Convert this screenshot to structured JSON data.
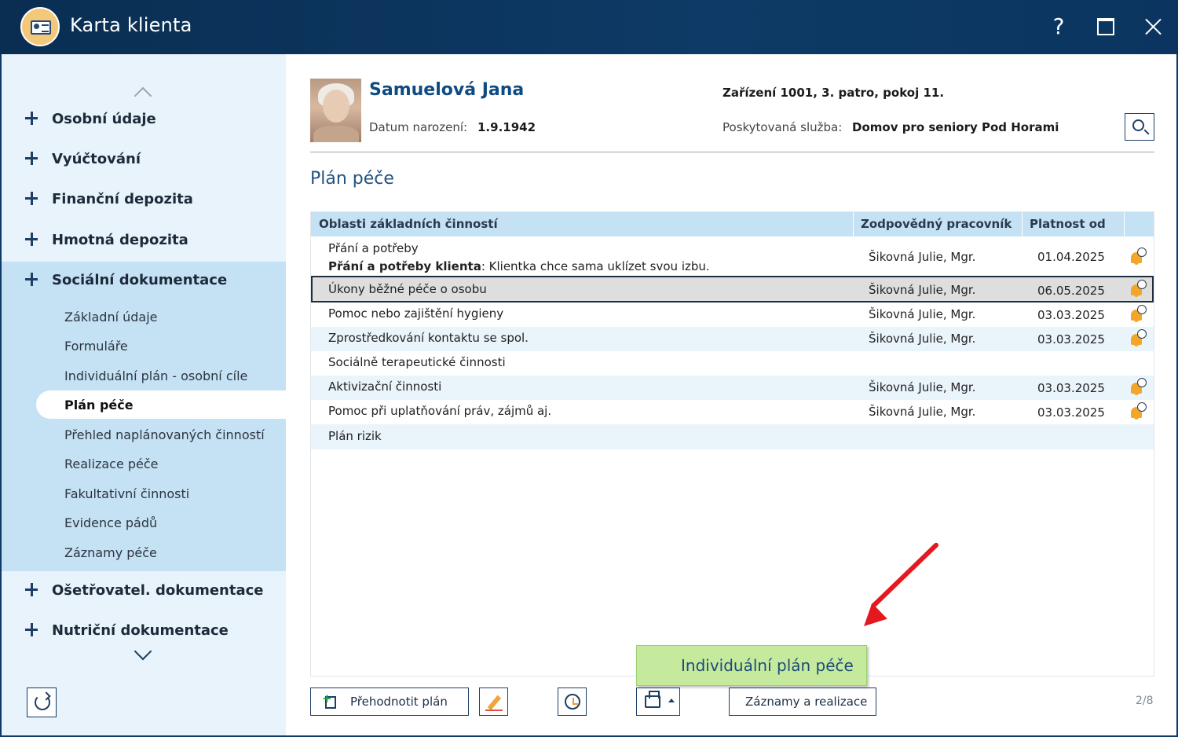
{
  "window": {
    "title": "Karta klienta",
    "help_label": "?"
  },
  "sidebar": {
    "items": [
      {
        "label": "Osobní údaje"
      },
      {
        "label": "Vyúčtování"
      },
      {
        "label": "Finanční depozita"
      },
      {
        "label": "Hmotná depozita"
      },
      {
        "label": "Sociální dokumentace"
      },
      {
        "label": "Ošetřovatel. dokumentace"
      },
      {
        "label": "Nutriční dokumentace"
      }
    ],
    "social_children": [
      {
        "label": "Základní údaje"
      },
      {
        "label": "Formuláře"
      },
      {
        "label": "Individuální plán - osobní cíle"
      },
      {
        "label": "Plán péče"
      },
      {
        "label": "Přehled naplánovaných činností"
      },
      {
        "label": "Realizace péče"
      },
      {
        "label": "Fakultativní činnosti"
      },
      {
        "label": "Evidence pádů"
      },
      {
        "label": "Záznamy péče"
      }
    ],
    "active_child": "Plán péče"
  },
  "client": {
    "name": "Samuelová Jana",
    "dob_label": "Datum narození:",
    "dob": "1.9.1942",
    "facility": "Zařízení 1001, 3. patro, pokoj 11.",
    "service_label": "Poskytovaná služba:",
    "service": "Domov pro seniory Pod Horami"
  },
  "section_title": "Plán péče",
  "table": {
    "headers": [
      "Oblasti základních činností",
      "Zodpovědný pracovník",
      "Platnost od"
    ],
    "rows": [
      {
        "area": "Přání a potřeby",
        "note_bold": "Přání a potřeby klienta",
        "note": ": Klientka chce sama uklízet svou izbu.",
        "worker": "Šikovná Julie, Mgr.",
        "date": "01.04.2025",
        "reminder": true
      },
      {
        "area": "Úkony běžné péče o osobu",
        "worker": "Šikovná Julie, Mgr.",
        "date": "06.05.2025",
        "reminder": true,
        "selected": true
      },
      {
        "area": "Pomoc nebo zajištění hygieny",
        "worker": "Šikovná Julie, Mgr.",
        "date": "03.03.2025",
        "reminder": true
      },
      {
        "area": "Zprostředkování kontaktu se spol.",
        "worker": "Šikovná Julie, Mgr.",
        "date": "03.03.2025",
        "reminder": true
      },
      {
        "area": "Sociálně terapeutické činnosti",
        "worker": "",
        "date": "",
        "reminder": false
      },
      {
        "area": "Aktivizační činnosti",
        "worker": "Šikovná Julie, Mgr.",
        "date": "03.03.2025",
        "reminder": true
      },
      {
        "area": "Pomoc při uplatňování práv, zájmů aj.",
        "worker": "Šikovná Julie, Mgr.",
        "date": "03.03.2025",
        "reminder": true
      },
      {
        "area": "Plán rizik",
        "worker": "",
        "date": "",
        "reminder": false
      }
    ]
  },
  "toolbar": {
    "reevaluate_label": "Přehodnotit plán",
    "records_label": "Záznamy a realizace",
    "tooltip": "Individuální plán péče",
    "page_indicator": "2/8"
  },
  "colors": {
    "titlebar": "#0d3a66",
    "accent": "#0f4a80",
    "header_row": "#c5e1f4",
    "tooltip": "#c5ea9e",
    "annotation_arrow": "#e3191f"
  }
}
